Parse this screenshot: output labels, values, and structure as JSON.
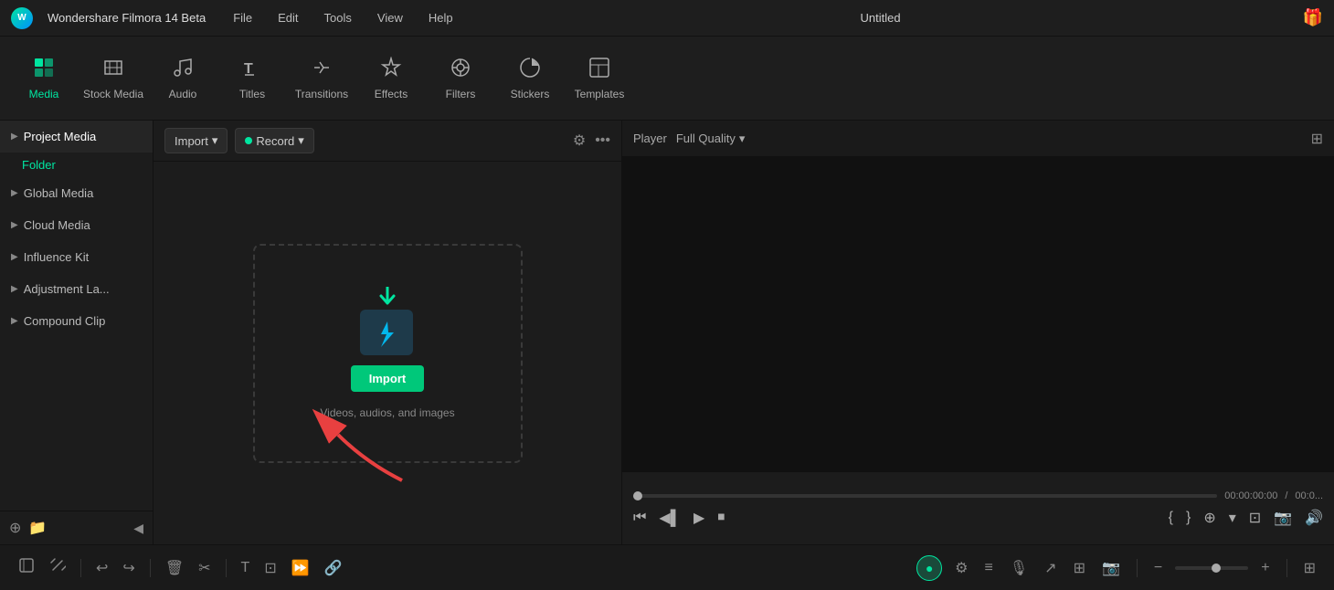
{
  "titlebar": {
    "app_name": "Wondershare Filmora 14 Beta",
    "menu_items": [
      "File",
      "Edit",
      "Tools",
      "View",
      "Help"
    ],
    "project_title": "Untitled"
  },
  "toolbar": {
    "items": [
      {
        "id": "media",
        "label": "Media",
        "icon": "▣",
        "active": true
      },
      {
        "id": "stock_media",
        "label": "Stock Media",
        "icon": "♫"
      },
      {
        "id": "audio",
        "label": "Audio",
        "icon": "♪"
      },
      {
        "id": "titles",
        "label": "Titles",
        "icon": "T"
      },
      {
        "id": "transitions",
        "label": "Transitions",
        "icon": "↔"
      },
      {
        "id": "effects",
        "label": "Effects",
        "icon": "✦"
      },
      {
        "id": "filters",
        "label": "Filters",
        "icon": "⊕"
      },
      {
        "id": "stickers",
        "label": "Stickers",
        "icon": "★"
      },
      {
        "id": "templates",
        "label": "Templates",
        "icon": "⊞"
      }
    ]
  },
  "sidebar": {
    "items": [
      {
        "id": "project_media",
        "label": "Project Media",
        "active": true
      },
      {
        "id": "folder",
        "label": "Folder",
        "type": "folder"
      },
      {
        "id": "global_media",
        "label": "Global Media"
      },
      {
        "id": "cloud_media",
        "label": "Cloud Media"
      },
      {
        "id": "influence_kit",
        "label": "Influence Kit"
      },
      {
        "id": "adjustment_layer",
        "label": "Adjustment La..."
      },
      {
        "id": "compound_clip",
        "label": "Compound Clip"
      }
    ],
    "add_folder_label": "Add Folder",
    "new_item_label": "New",
    "collapse_label": "Collapse"
  },
  "content": {
    "import_label": "Import",
    "record_label": "Record",
    "filter_icon": "⚙",
    "more_icon": "…",
    "dropzone": {
      "hint": "Videos, audios, and images",
      "import_button": "Import"
    }
  },
  "player": {
    "player_label": "Player",
    "quality_label": "Full Quality",
    "time_current": "00:00:00:00",
    "time_separator": "/",
    "time_total": "00:0..."
  },
  "bottom_bar": {
    "icons": [
      "select",
      "trim",
      "undo",
      "redo",
      "delete",
      "cut",
      "text",
      "crop",
      "speed",
      "link"
    ]
  }
}
